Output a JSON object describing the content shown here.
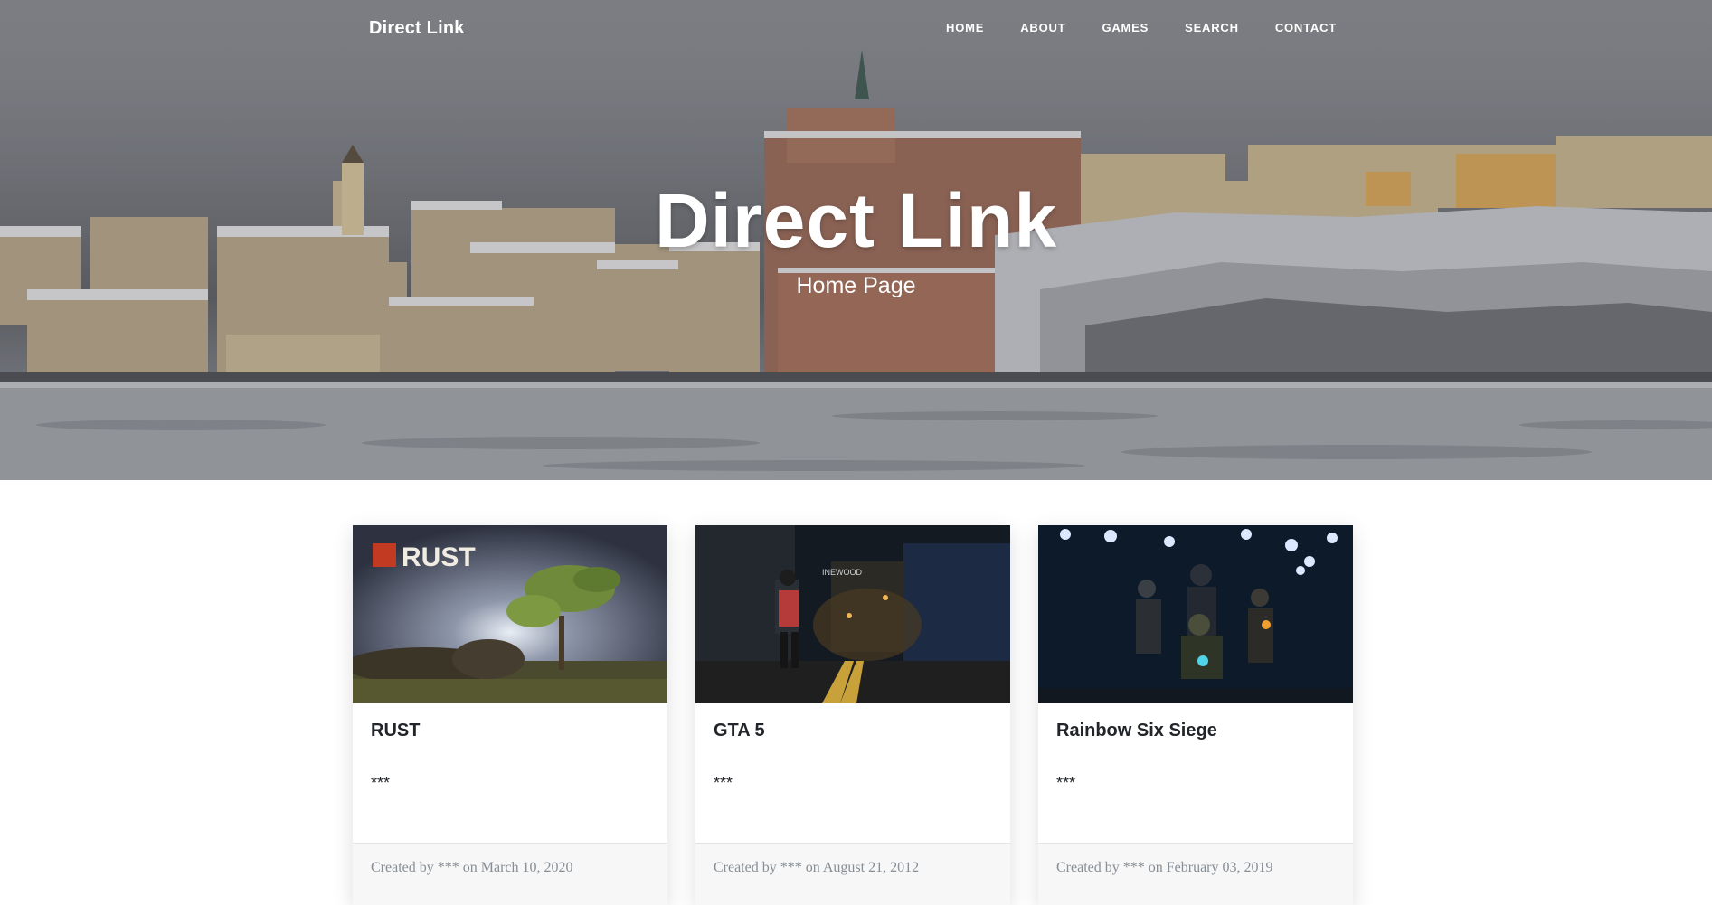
{
  "brand": "Direct Link",
  "nav": {
    "items": [
      "HOME",
      "ABOUT",
      "GAMES",
      "SEARCH",
      "CONTACT"
    ]
  },
  "hero": {
    "title": "Direct Link",
    "subtitle": "Home Page"
  },
  "cards": [
    {
      "title": "RUST",
      "text": "***",
      "footer": "Created by *** on March 10, 2020",
      "image_label": "RUST"
    },
    {
      "title": "GTA 5",
      "text": "***",
      "footer": "Created by *** on August 21, 2012",
      "image_label": "INEWOOD"
    },
    {
      "title": "Rainbow Six Siege",
      "text": "***",
      "footer": "Created by *** on February 03, 2019"
    }
  ]
}
